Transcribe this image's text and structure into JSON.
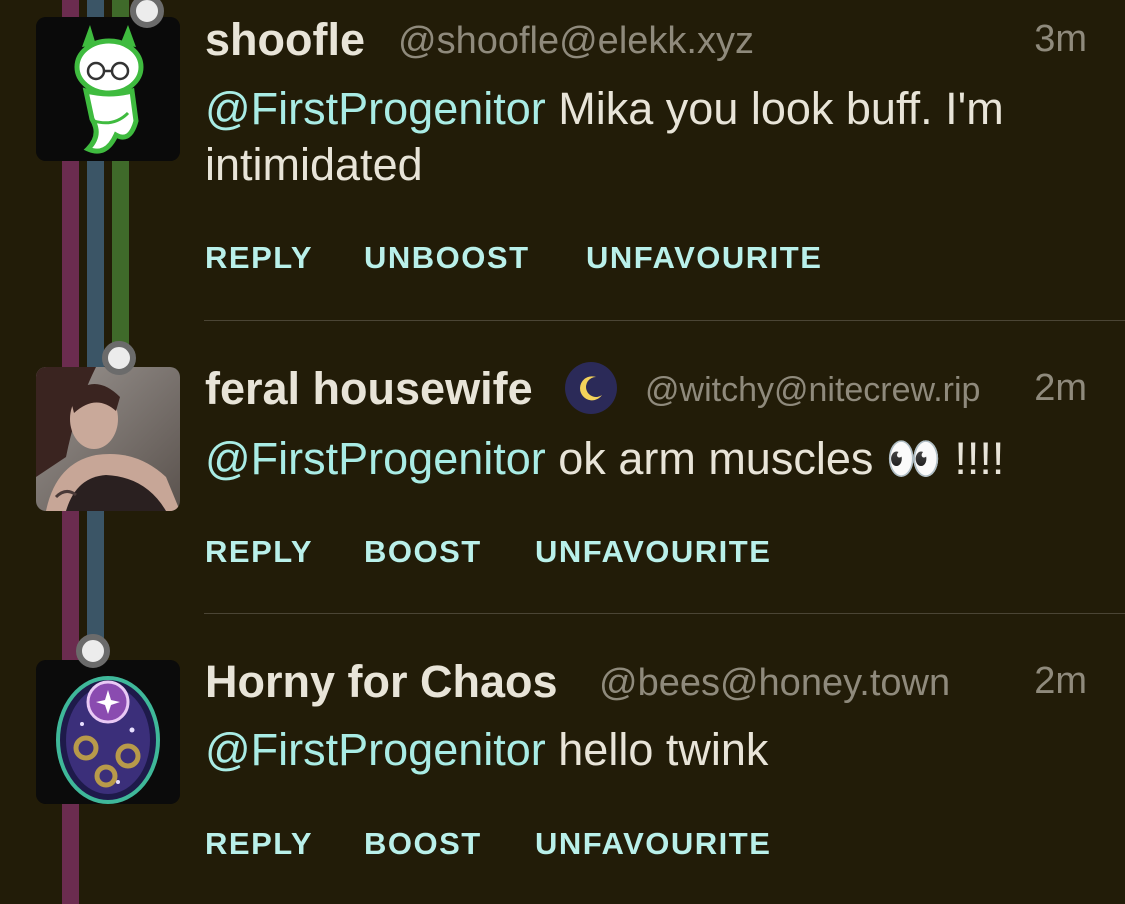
{
  "posts": [
    {
      "display_name": "shoofle",
      "handle": "@shoofle@elekk.xyz",
      "time": "3m",
      "mention": "@FirstProgenitor",
      "text_line1": " Mika you look buff. I'm",
      "text_line2": "intimidated",
      "actions": [
        "REPLY",
        "UNBOOST",
        "UNFAVOURITE"
      ]
    },
    {
      "display_name": "feral housewife",
      "handle": "@witchy@nitecrew.rip",
      "time": "2m",
      "mention": "@FirstProgenitor",
      "text": " ok arm muscles 👀 !!!!",
      "actions": [
        "REPLY",
        "BOOST",
        "UNFAVOURITE"
      ]
    },
    {
      "display_name": "Horny for Chaos",
      "handle": "@bees@honey.town",
      "time": "2m",
      "mention": "@FirstProgenitor",
      "text": " hello twink",
      "actions": [
        "REPLY",
        "BOOST",
        "UNFAVOURITE"
      ]
    }
  ],
  "icons": {
    "avatar_1": "ghost-with-glasses-avatar",
    "avatar_2": "photo-avatar",
    "avatar_3": "cosmic-egg-avatar",
    "name_badge_2": "crescent-moon-icon"
  }
}
